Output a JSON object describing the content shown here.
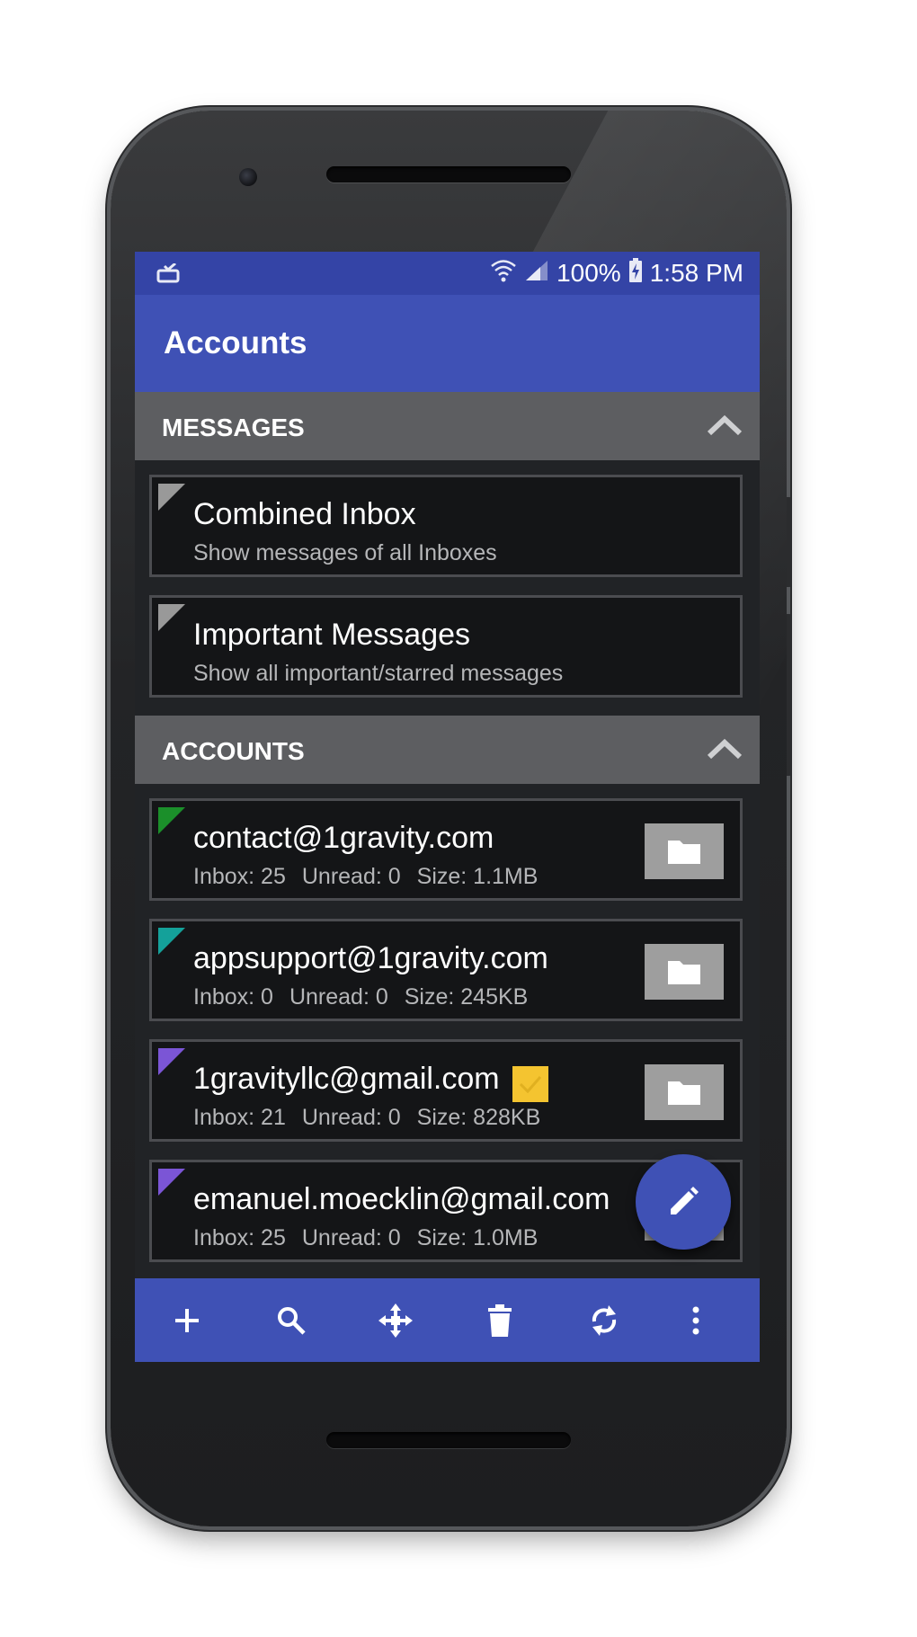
{
  "status_bar": {
    "notification_icon": "email-notification-icon",
    "wifi_icon": "wifi-icon",
    "signal_icon": "cell-signal-icon",
    "battery_percent": "100%",
    "battery_icon": "battery-charging-icon",
    "time": "1:58 PM"
  },
  "app_bar": {
    "title": "Accounts"
  },
  "messages_section": {
    "label": "MESSAGES",
    "collapse_icon": "chevron-up-icon",
    "items": [
      {
        "title": "Combined Inbox",
        "subtitle": "Show messages of all Inboxes",
        "color": "#9e9e9e"
      },
      {
        "title": "Important Messages",
        "subtitle": "Show all important/starred messages",
        "color": "#9e9e9e"
      }
    ]
  },
  "accounts_section": {
    "label": "ACCOUNTS",
    "collapse_icon": "chevron-up-icon",
    "items": [
      {
        "email": "contact@1gravity.com",
        "inbox": "Inbox: 25",
        "unread": "Unread: 0",
        "size": "Size: 1.1MB",
        "color": "#1b8f2a",
        "checked": false
      },
      {
        "email": "appsupport@1gravity.com",
        "inbox": "Inbox: 0",
        "unread": "Unread: 0",
        "size": "Size: 245KB",
        "color": "#14a19a",
        "checked": false
      },
      {
        "email": "1gravityllc@gmail.com",
        "inbox": "Inbox: 21",
        "unread": "Unread: 0",
        "size": "Size: 828KB",
        "color": "#7b55d6",
        "checked": true
      },
      {
        "email": "emanuel.moecklin@gmail.com",
        "inbox": "Inbox: 25",
        "unread": "Unread: 0",
        "size": "Size: 1.0MB",
        "color": "#7b55d6",
        "checked": false
      }
    ]
  },
  "fab": {
    "icon": "pencil-compose-icon"
  },
  "bottom_bar": {
    "actions": [
      {
        "name": "add-account",
        "icon": "plus-icon"
      },
      {
        "name": "search",
        "icon": "search-icon"
      },
      {
        "name": "move",
        "icon": "move-arrows-icon"
      },
      {
        "name": "delete",
        "icon": "trash-icon"
      },
      {
        "name": "refresh",
        "icon": "sync-icon"
      },
      {
        "name": "more",
        "icon": "overflow-menu-icon"
      }
    ]
  },
  "colors": {
    "primary": "#3f51b5",
    "status_bar": "#3444a6",
    "section_header": "#5d5e61",
    "card_background": "#141517",
    "checkbox_badge": "#f4c430"
  }
}
